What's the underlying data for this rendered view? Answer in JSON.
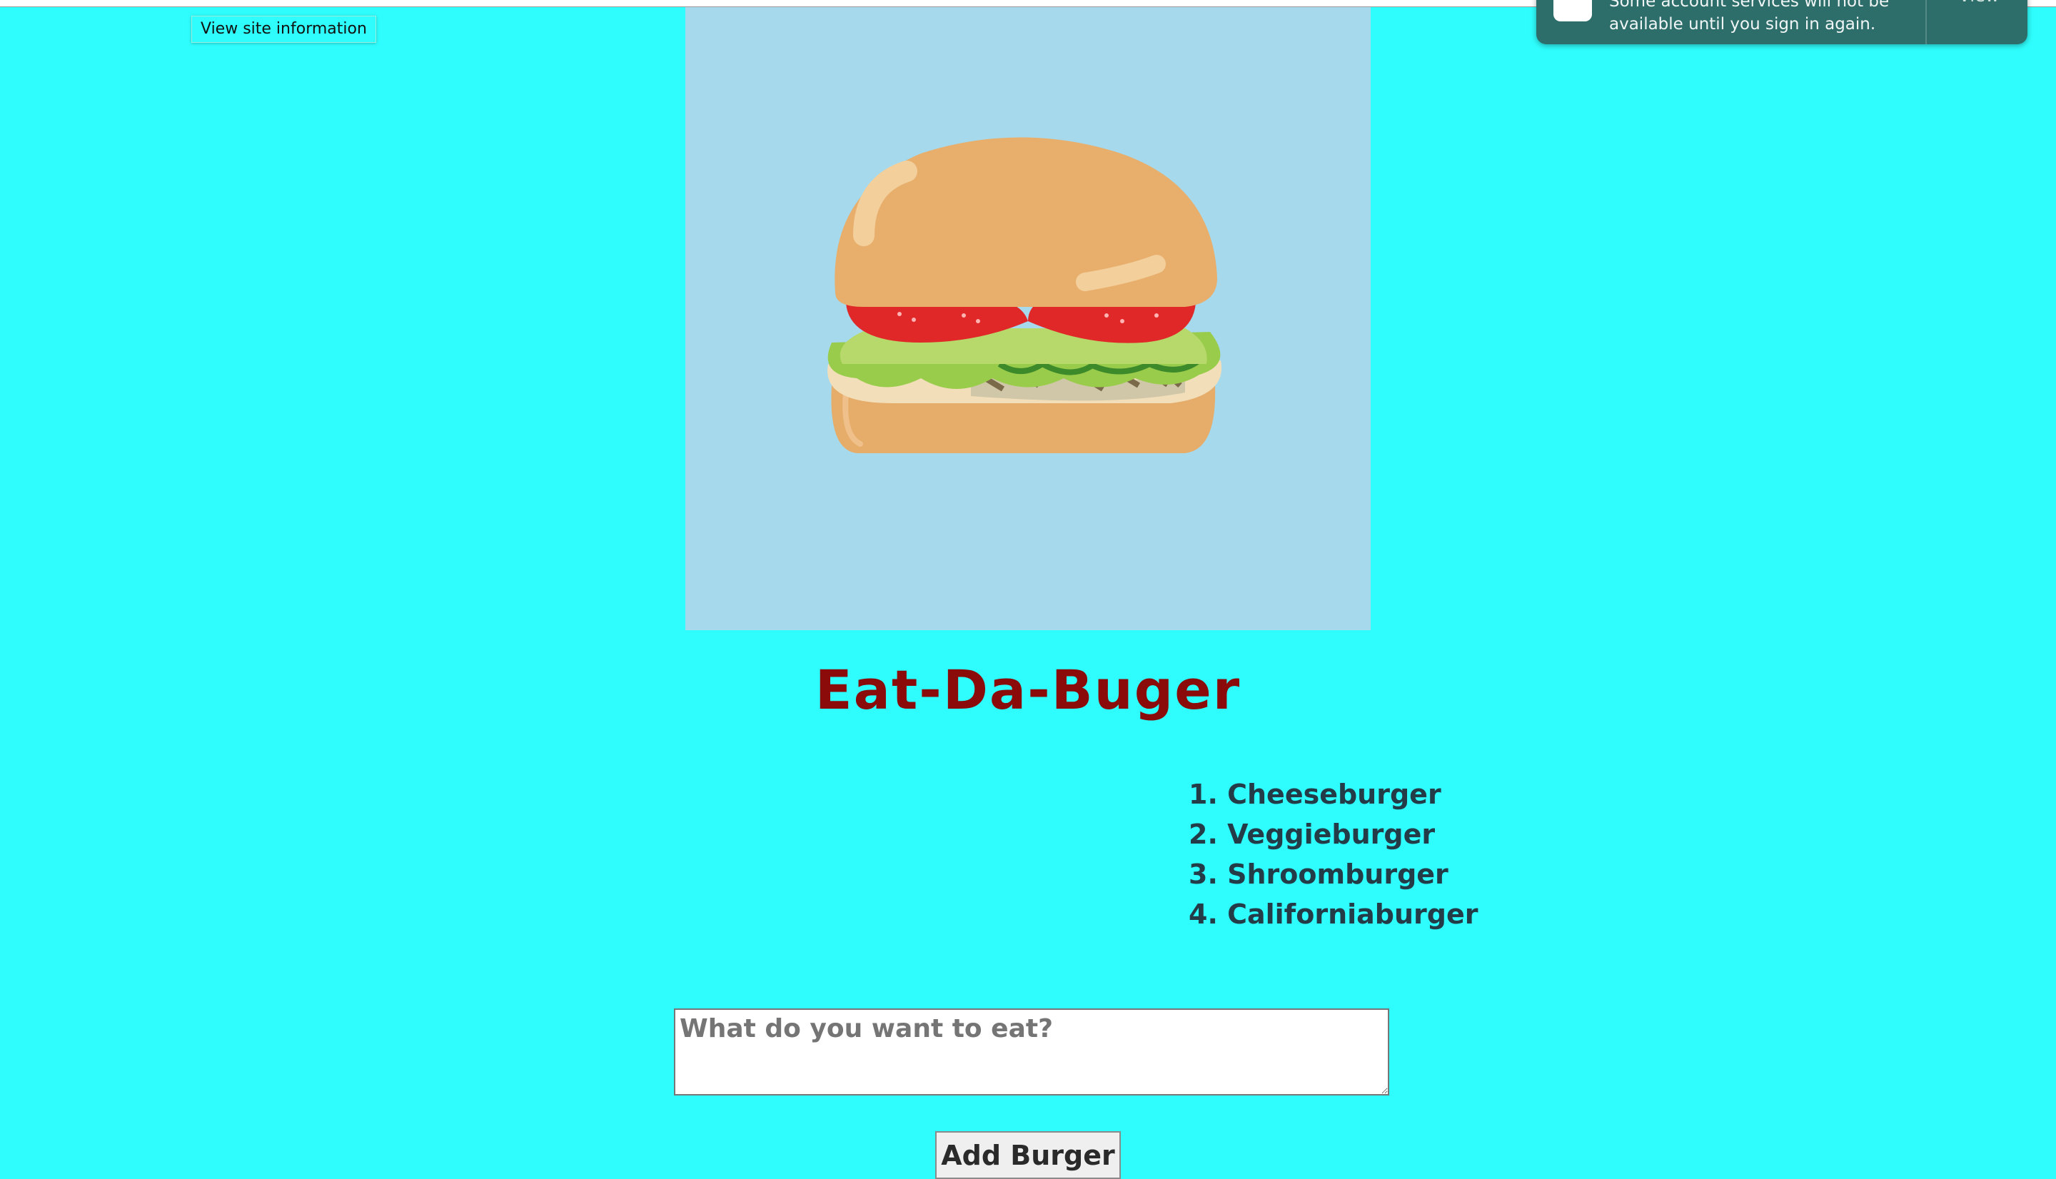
{
  "browser": {
    "tooltip": "View site information"
  },
  "notification": {
    "icon": "account-app-icon",
    "message": "Some account services will not be available until you sign in again.",
    "action_label": "View"
  },
  "hero": {
    "image": "burger-illustration",
    "background": "#a6d9ec"
  },
  "page": {
    "background": "#2ffdfd",
    "title": "Eat-Da-Buger",
    "title_color": "#8b0a0a"
  },
  "burgers": [
    "1. Cheeseburger",
    "2. Veggieburger",
    "3. Shroomburger",
    "4. Californiaburger"
  ],
  "form": {
    "placeholder": "What do you want to eat?",
    "value": "",
    "submit_label": "Add Burger"
  }
}
